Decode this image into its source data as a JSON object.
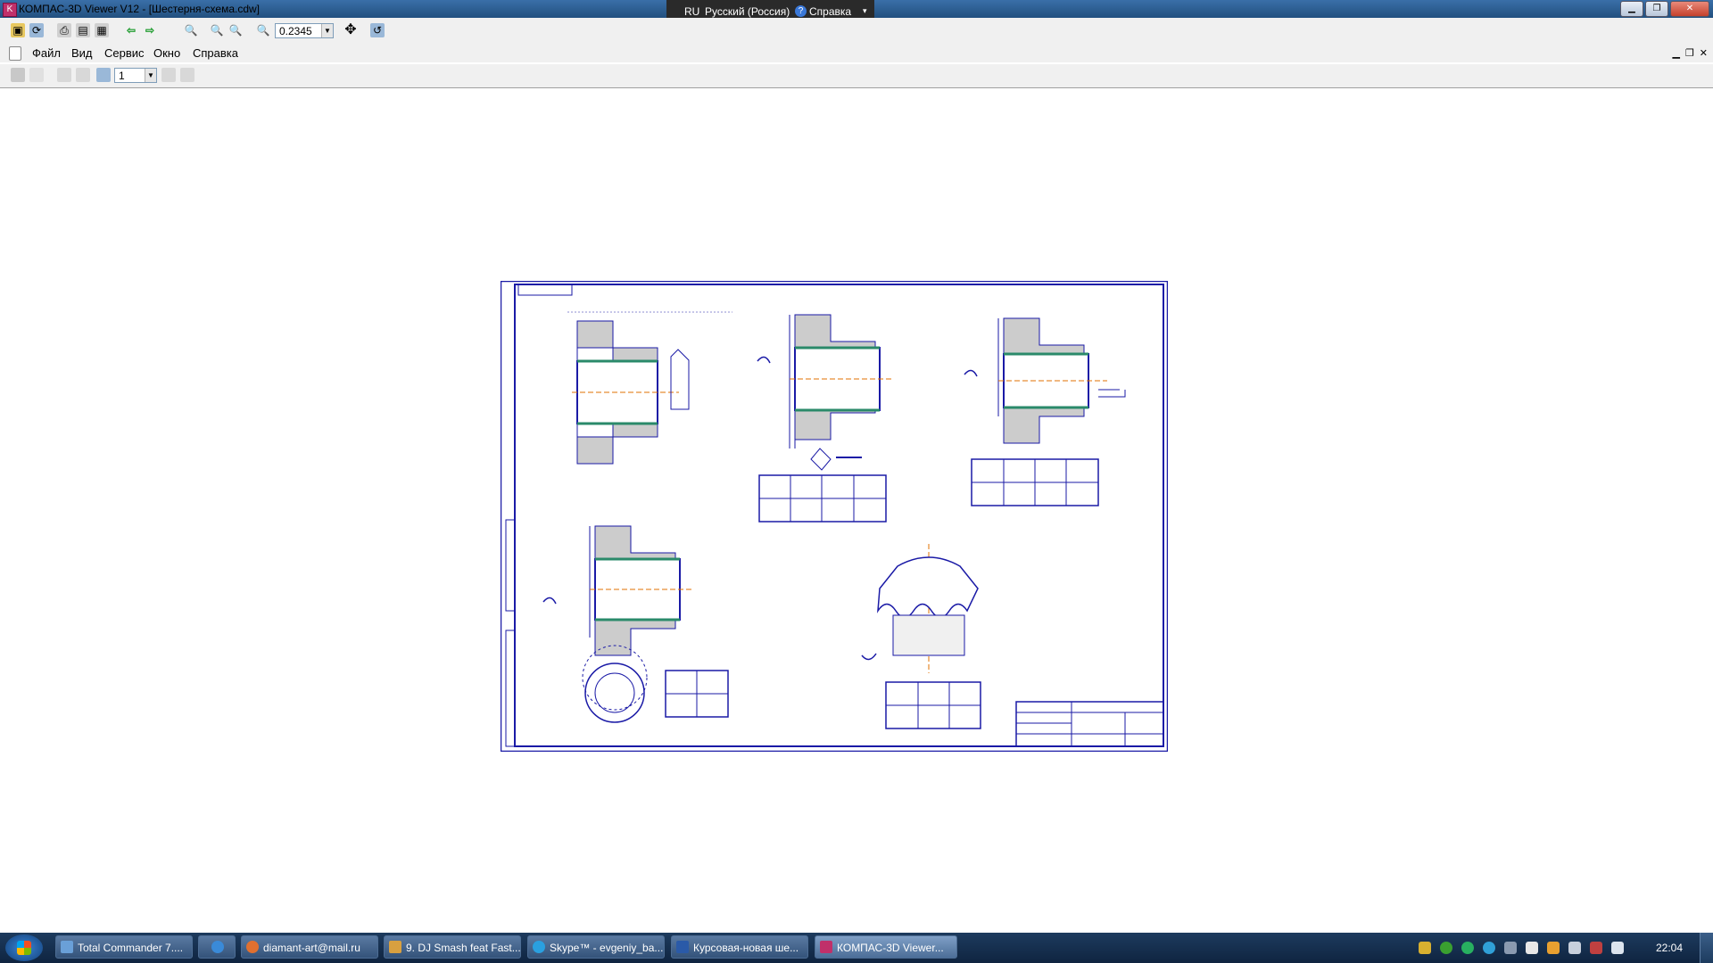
{
  "window": {
    "title": "КОМПАС-3D Viewer V12 - [Шестерня-схема.cdw]",
    "app_icon": "kompas-icon",
    "controls": [
      "minimize",
      "maximize",
      "close"
    ]
  },
  "language_bar": {
    "lang_code": "RU",
    "lang_name": "Русский (Россия)",
    "help_label": "Справка"
  },
  "toolbar": {
    "icons": [
      "open-icon",
      "open-recent-icon",
      "print-icon",
      "print-preview-icon",
      "page-setup-icon",
      "back-arrow-icon",
      "forward-arrow-icon",
      "zoom-window-icon",
      "zoom-in-icon",
      "zoom-out-icon",
      "zoom-scale-icon",
      "pan-icon",
      "refresh-icon"
    ],
    "zoom_value": "0.2345"
  },
  "menu": {
    "items": [
      {
        "label": "Файл",
        "hotkey": "Ф"
      },
      {
        "label": "Вид",
        "hotkey": "В"
      },
      {
        "label": "Сервис",
        "hotkey": "С"
      },
      {
        "label": "Окно",
        "hotkey": "О"
      },
      {
        "label": "Справка",
        "hotkey": "С"
      }
    ]
  },
  "toolbar2": {
    "page_value": "1"
  },
  "drawing": {
    "sheet_format": "A3 landscape",
    "line_color": "#1a1aa6",
    "fill_color": "#2a8a6a",
    "axis_color": "#e07000"
  },
  "taskbar": {
    "items": [
      {
        "label": "Total Commander 7....",
        "icon": "total-commander-icon",
        "active": false
      },
      {
        "label": "",
        "icon": "internet-explorer-icon",
        "active": false
      },
      {
        "label": "diamant-art@mail.ru",
        "icon": "mail-agent-icon",
        "active": false
      },
      {
        "label": "9. DJ Smash feat Fast...",
        "icon": "winamp-icon",
        "active": false
      },
      {
        "label": "Skype™ - evgeniy_ba...",
        "icon": "skype-icon",
        "active": false
      },
      {
        "label": "Курсовая-новая ше...",
        "icon": "word-document-icon",
        "active": false
      },
      {
        "label": "КОМПАС-3D Viewer...",
        "icon": "kompas-icon",
        "active": true
      }
    ],
    "tray_icons": [
      "tray-app-1-icon",
      "tray-app-2-icon",
      "tray-app-3-icon",
      "tray-app-4-icon",
      "tray-app-5-icon",
      "flag-icon",
      "tray-app-7-icon",
      "network-icon",
      "speaker-icon",
      "sound-icon"
    ],
    "clock": "22:04"
  },
  "colors": {
    "title_bar": "#2b5c91",
    "taskbar": "#1a3454",
    "accent_pink": "#c0306a"
  }
}
